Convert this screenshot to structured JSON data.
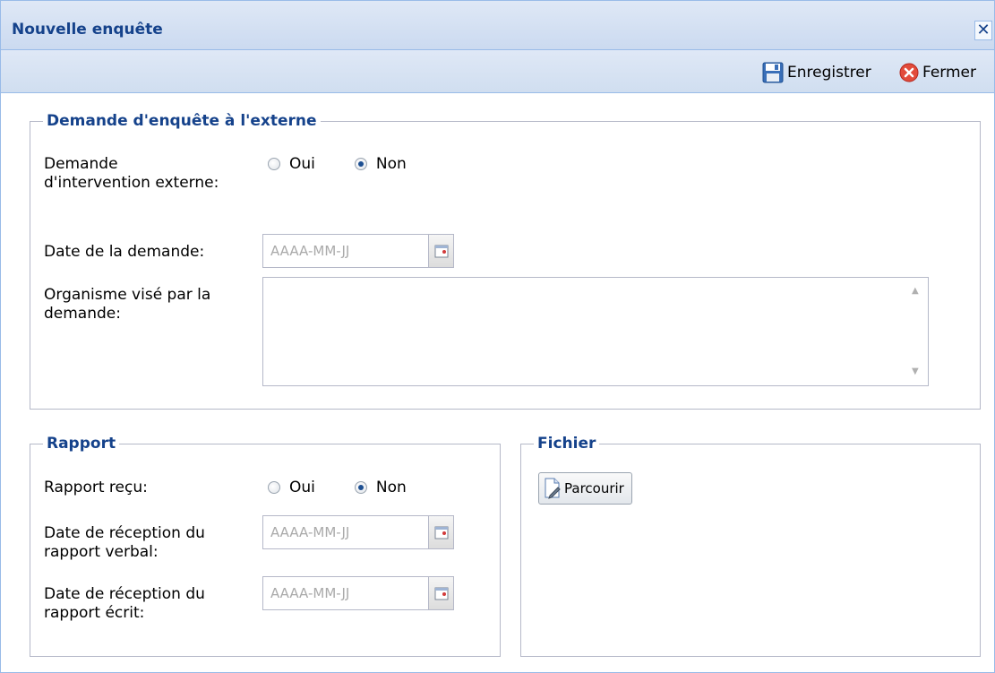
{
  "window": {
    "title": "Nouvelle enquête",
    "close_glyph": "✕"
  },
  "toolbar": {
    "save_label": "Enregistrer",
    "close_label": "Fermer",
    "save_icon": "floppy-disk-icon",
    "close_icon": "red-circle-x-icon"
  },
  "demande": {
    "legend": "Demande d'enquête à l'externe",
    "intervention_label": "Demande d'intervention externe:",
    "intervention_options": [
      "Oui",
      "Non"
    ],
    "intervention_selected": "Non",
    "date_label": "Date de la demande:",
    "date_placeholder": "AAAA-MM-JJ",
    "date_value": "",
    "organisme_label": "Organisme visé par la demande:",
    "organisme_value": ""
  },
  "rapport": {
    "legend": "Rapport",
    "recu_label": "Rapport reçu:",
    "recu_options": [
      "Oui",
      "Non"
    ],
    "recu_selected": "Non",
    "verbal_label": "Date de réception du rapport verbal:",
    "verbal_placeholder": "AAAA-MM-JJ",
    "ecrit_label": "Date de réception du rapport écrit:",
    "ecrit_placeholder": "AAAA-MM-JJ"
  },
  "fichier": {
    "legend": "Fichier",
    "browse_label": "Parcourir",
    "browse_icon": "document-pen-icon"
  },
  "colors": {
    "title_text": "#15428b",
    "header_bg": "#dfe8f6",
    "border": "#99bbe8",
    "field_border": "#b5b8c8"
  }
}
